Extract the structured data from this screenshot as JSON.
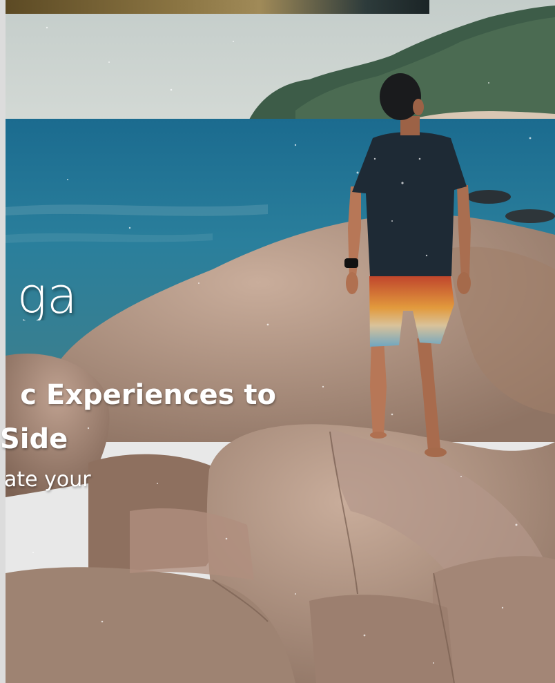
{
  "hero": {
    "title_fragment": "ga",
    "headline_line1": "c Experiences to",
    "headline_line2": "Side",
    "tagline_fragment": "ate your"
  },
  "colors": {
    "sea": "#1f6f93",
    "sky": "#c9d3d0",
    "rock": "#b59a88",
    "shirt": "#1e2a35"
  }
}
